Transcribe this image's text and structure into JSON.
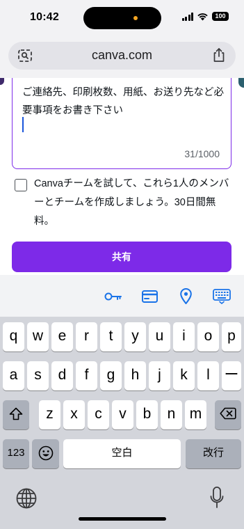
{
  "status_bar": {
    "time": "10:42",
    "battery": "100"
  },
  "browser": {
    "url": "canva.com"
  },
  "form": {
    "message_text": "ご連絡先、印刷枚数、用紙、お送り先など必要事項をお書き下さい",
    "char_counter": "31/1000",
    "team_checkbox_label": "Canvaチームを試して、これら1人のメンバーとチームを作成しましょう。30日間無料。",
    "share_button": "共有"
  },
  "keyboard": {
    "row1": [
      "q",
      "w",
      "e",
      "r",
      "t",
      "y",
      "u",
      "i",
      "o",
      "p"
    ],
    "row2": [
      "a",
      "s",
      "d",
      "f",
      "g",
      "h",
      "j",
      "k",
      "l",
      "ー"
    ],
    "row3": [
      "z",
      "x",
      "c",
      "v",
      "b",
      "n",
      "m"
    ],
    "numbers_key": "123",
    "space_key": "空白",
    "return_key": "改行"
  },
  "colors": {
    "accent": "#7d2ae8",
    "ios_blue": "#1a73e8"
  }
}
